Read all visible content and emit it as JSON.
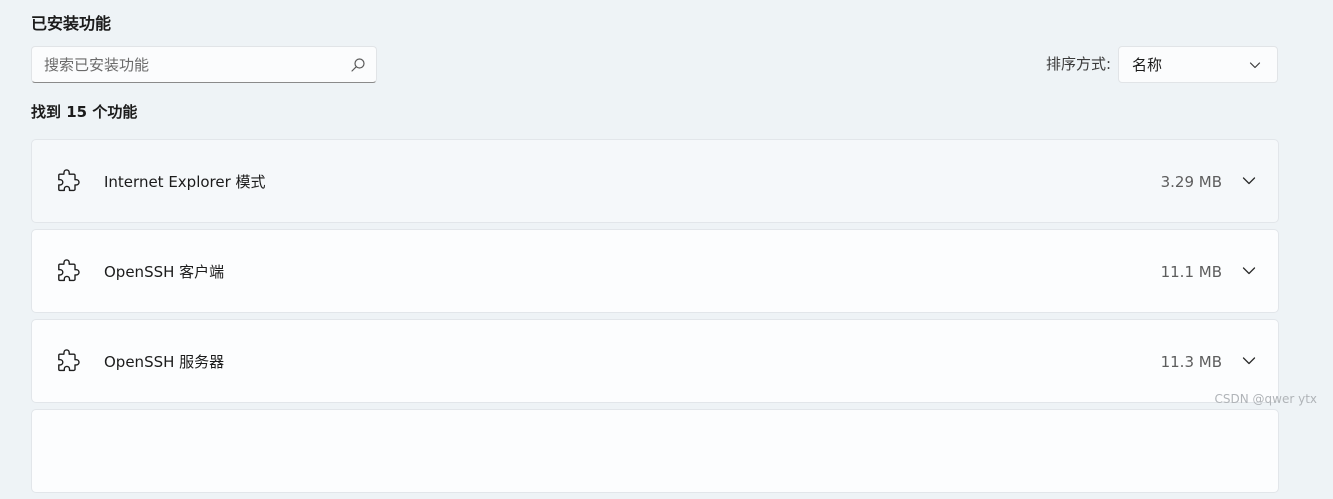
{
  "section": {
    "title": "已安装功能"
  },
  "search": {
    "placeholder": "搜索已安装功能",
    "value": "",
    "icon": "search-icon"
  },
  "sort": {
    "label": "排序方式:",
    "selected": "名称",
    "icon": "chevron-down-icon"
  },
  "results": {
    "count_text": "找到 15 个功能"
  },
  "features": [
    {
      "name": "Internet Explorer 模式",
      "size": "3.29 MB",
      "icon": "puzzle-icon"
    },
    {
      "name": "OpenSSH 客户端",
      "size": "11.1 MB",
      "icon": "puzzle-icon"
    },
    {
      "name": "OpenSSH 服务器",
      "size": "11.3 MB",
      "icon": "puzzle-icon"
    },
    {
      "name": "",
      "size": "",
      "icon": "puzzle-icon"
    }
  ],
  "watermark": "CSDN @qwer ytx"
}
